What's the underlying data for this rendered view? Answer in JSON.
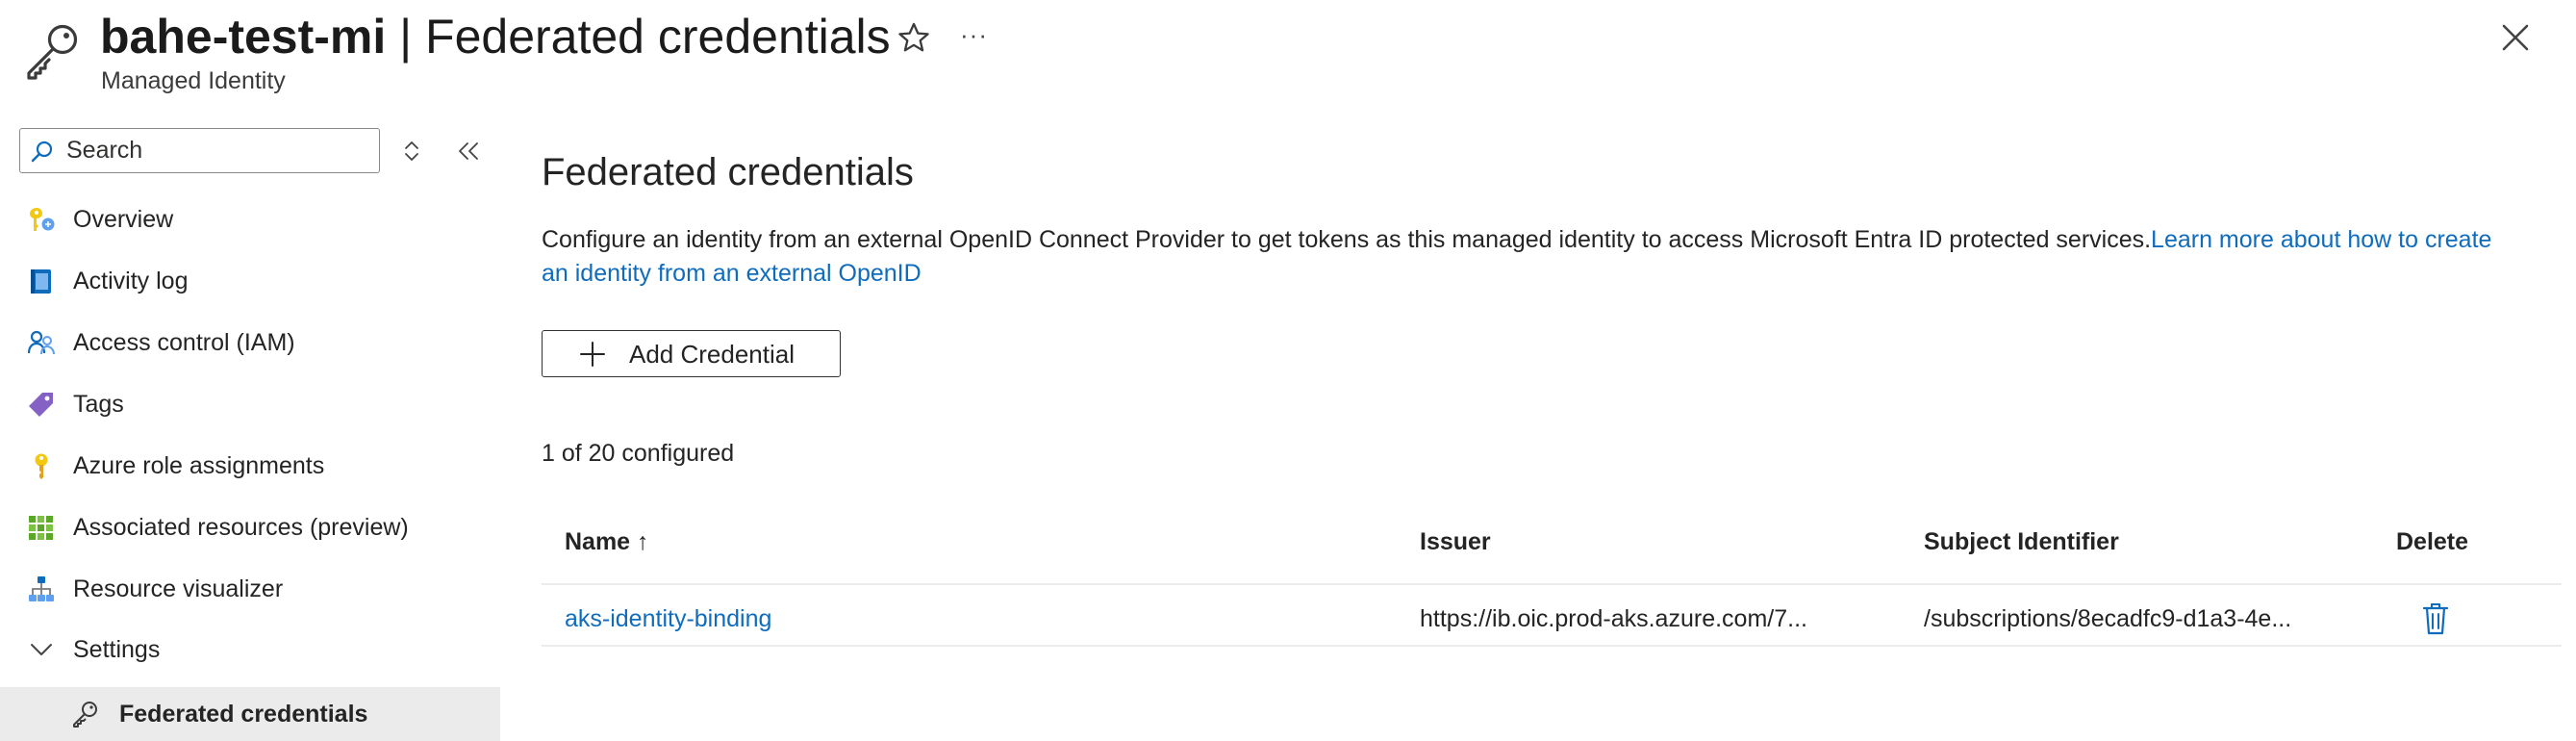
{
  "header": {
    "resource_name": "bahe-test-mi",
    "separator": " | ",
    "page_name": "Federated credentials",
    "subtitle": "Managed Identity",
    "icons": {
      "resource": "key-icon",
      "favorite": "star-icon",
      "more": "more-icon",
      "close": "close-icon"
    },
    "more_glyph": "···"
  },
  "sidebar": {
    "search": {
      "placeholder": "Search",
      "value": ""
    },
    "items": [
      {
        "label": "Overview",
        "icon": "overview-icon"
      },
      {
        "label": "Activity log",
        "icon": "activity-log-icon"
      },
      {
        "label": "Access control (IAM)",
        "icon": "people-icon"
      },
      {
        "label": "Tags",
        "icon": "tag-icon"
      },
      {
        "label": "Azure role assignments",
        "icon": "key-icon"
      },
      {
        "label": "Associated resources (preview)",
        "icon": "grid-icon"
      },
      {
        "label": "Resource visualizer",
        "icon": "hierarchy-icon"
      },
      {
        "label": "Settings",
        "icon": "chevron-down-icon",
        "expanded": true
      },
      {
        "label": "Federated credentials",
        "icon": "key-icon",
        "selected": true
      }
    ]
  },
  "main": {
    "title": "Federated credentials",
    "description": "Configure an identity from an external OpenID Connect Provider to get tokens as this managed identity to access Microsoft Entra ID protected services.",
    "learn_more": "Learn more about how to create an identity from an external OpenID",
    "add_button": "Add Credential",
    "count_text": "1 of 20 configured",
    "table": {
      "columns": {
        "name": "Name",
        "sort_indicator": "↑",
        "issuer": "Issuer",
        "subject": "Subject Identifier",
        "delete": "Delete"
      },
      "rows": [
        {
          "name": "aks-identity-binding",
          "issuer": "https://ib.oic.prod-aks.azure.com/7...",
          "subject": "/subscriptions/8ecadfc9-d1a3-4e..."
        }
      ]
    }
  },
  "colors": {
    "link": "#0f6cbd",
    "selected_bg": "#ebebeb",
    "text": "#242424",
    "divider": "#edebe9"
  }
}
